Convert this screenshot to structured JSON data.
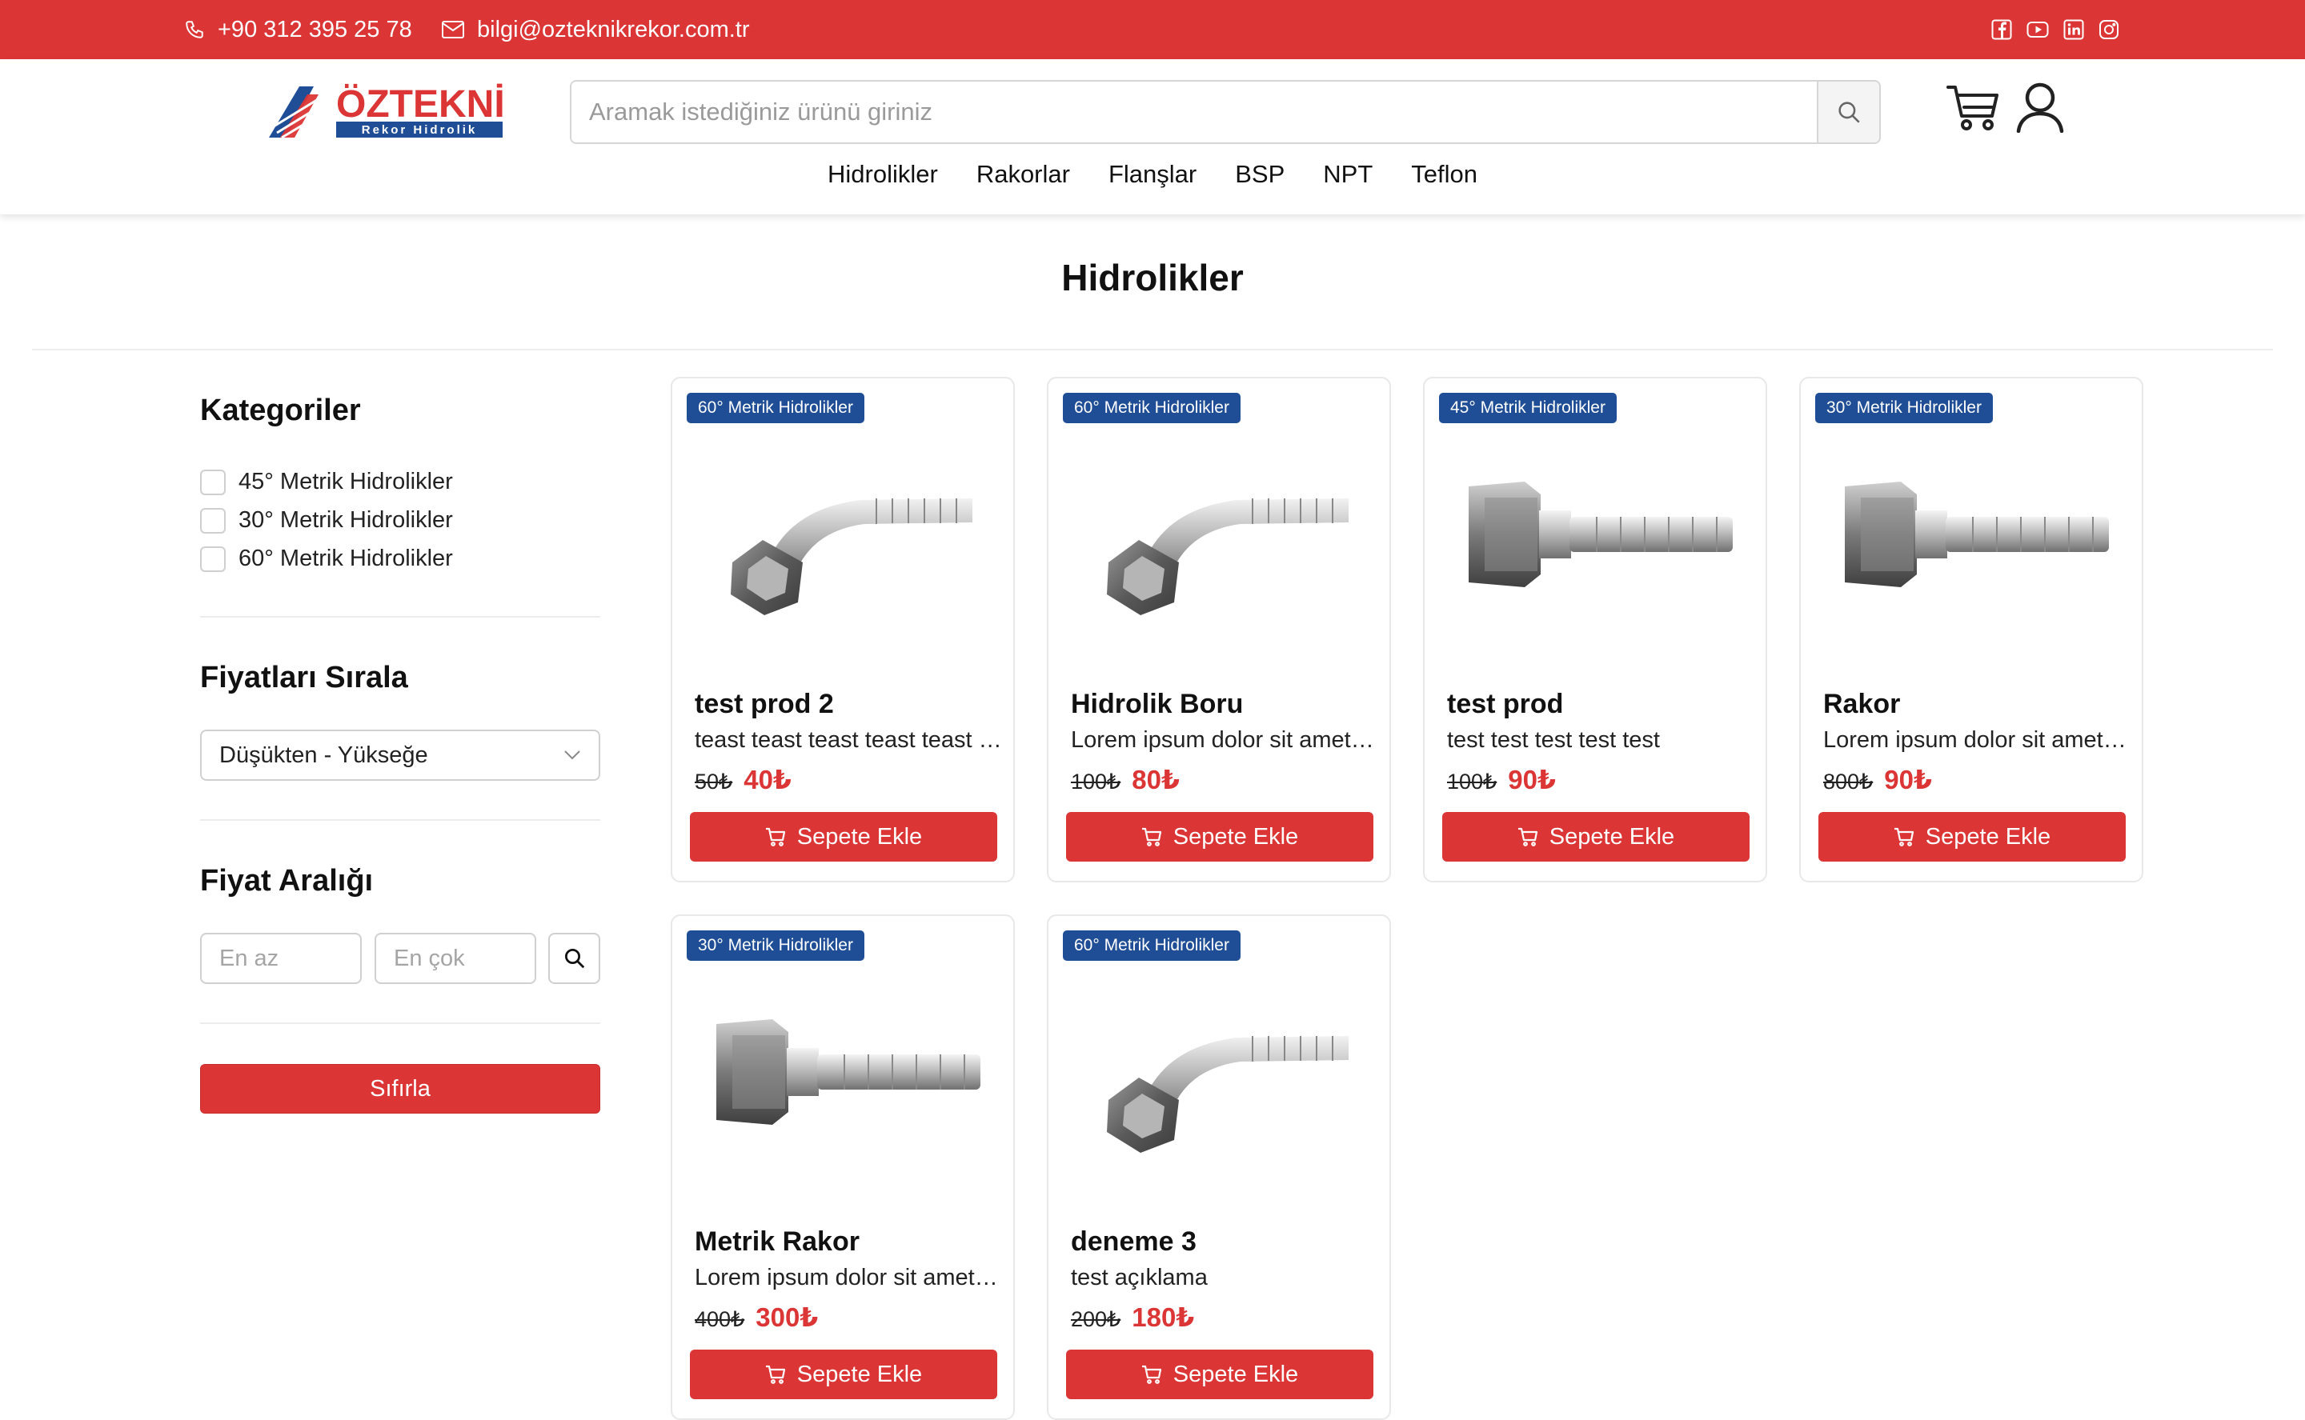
{
  "topbar": {
    "phone": "+90 312 395 25 78",
    "email": "bilgi@ozteknikrekor.com.tr",
    "social_icons": [
      "facebook-icon",
      "youtube-icon",
      "linkedin-icon",
      "instagram-icon"
    ]
  },
  "header": {
    "logo_text": "ÖZTEKNİK",
    "logo_subtext": "Rekor Hidrolik",
    "search_placeholder": "Aramak istediğiniz ürünü giriniz",
    "nav": [
      "Hidrolikler",
      "Rakorlar",
      "Flanşlar",
      "BSP",
      "NPT",
      "Teflon"
    ]
  },
  "page": {
    "title": "Hidrolikler"
  },
  "sidebar": {
    "categories_heading": "Kategoriler",
    "categories": [
      "45° Metrik Hidrolikler",
      "30° Metrik Hidrolikler",
      "60° Metrik Hidrolikler"
    ],
    "sort_heading": "Fiyatları Sırala",
    "sort_value": "Düşükten - Yükseğe",
    "range_heading": "Fiyat Aralığı",
    "min_placeholder": "En az",
    "max_placeholder": "En çok",
    "reset_label": "Sıfırla"
  },
  "colors": {
    "accent_red": "#dc3535",
    "badge_blue": "#1f4e96"
  },
  "add_to_cart_label": "Sepete Ekle",
  "products": [
    {
      "badge": "60° Metrik Hidrolikler",
      "name": "test prod 2",
      "desc": "teast teast teast teast teast teast",
      "old_price": "50₺",
      "new_price": "40₺",
      "shape": "angled"
    },
    {
      "badge": "60° Metrik Hidrolikler",
      "name": "Hidrolik Boru",
      "desc": "Lorem ipsum dolor sit amet consectetur",
      "old_price": "100₺",
      "new_price": "80₺",
      "shape": "angled"
    },
    {
      "badge": "45° Metrik Hidrolikler",
      "name": "test prod",
      "desc": "test test test test test",
      "old_price": "100₺",
      "new_price": "90₺",
      "shape": "straight"
    },
    {
      "badge": "30° Metrik Hidrolikler",
      "name": "Rakor",
      "desc": "Lorem ipsum dolor sit amet consectetur",
      "old_price": "800₺",
      "new_price": "90₺",
      "shape": "straight"
    },
    {
      "badge": "30° Metrik Hidrolikler",
      "name": "Metrik Rakor",
      "desc": "Lorem ipsum dolor sit amet consectetur",
      "old_price": "400₺",
      "new_price": "300₺",
      "shape": "straight"
    },
    {
      "badge": "60° Metrik Hidrolikler",
      "name": "deneme 3",
      "desc": "test açıklama",
      "old_price": "200₺",
      "new_price": "180₺",
      "shape": "angled"
    }
  ]
}
